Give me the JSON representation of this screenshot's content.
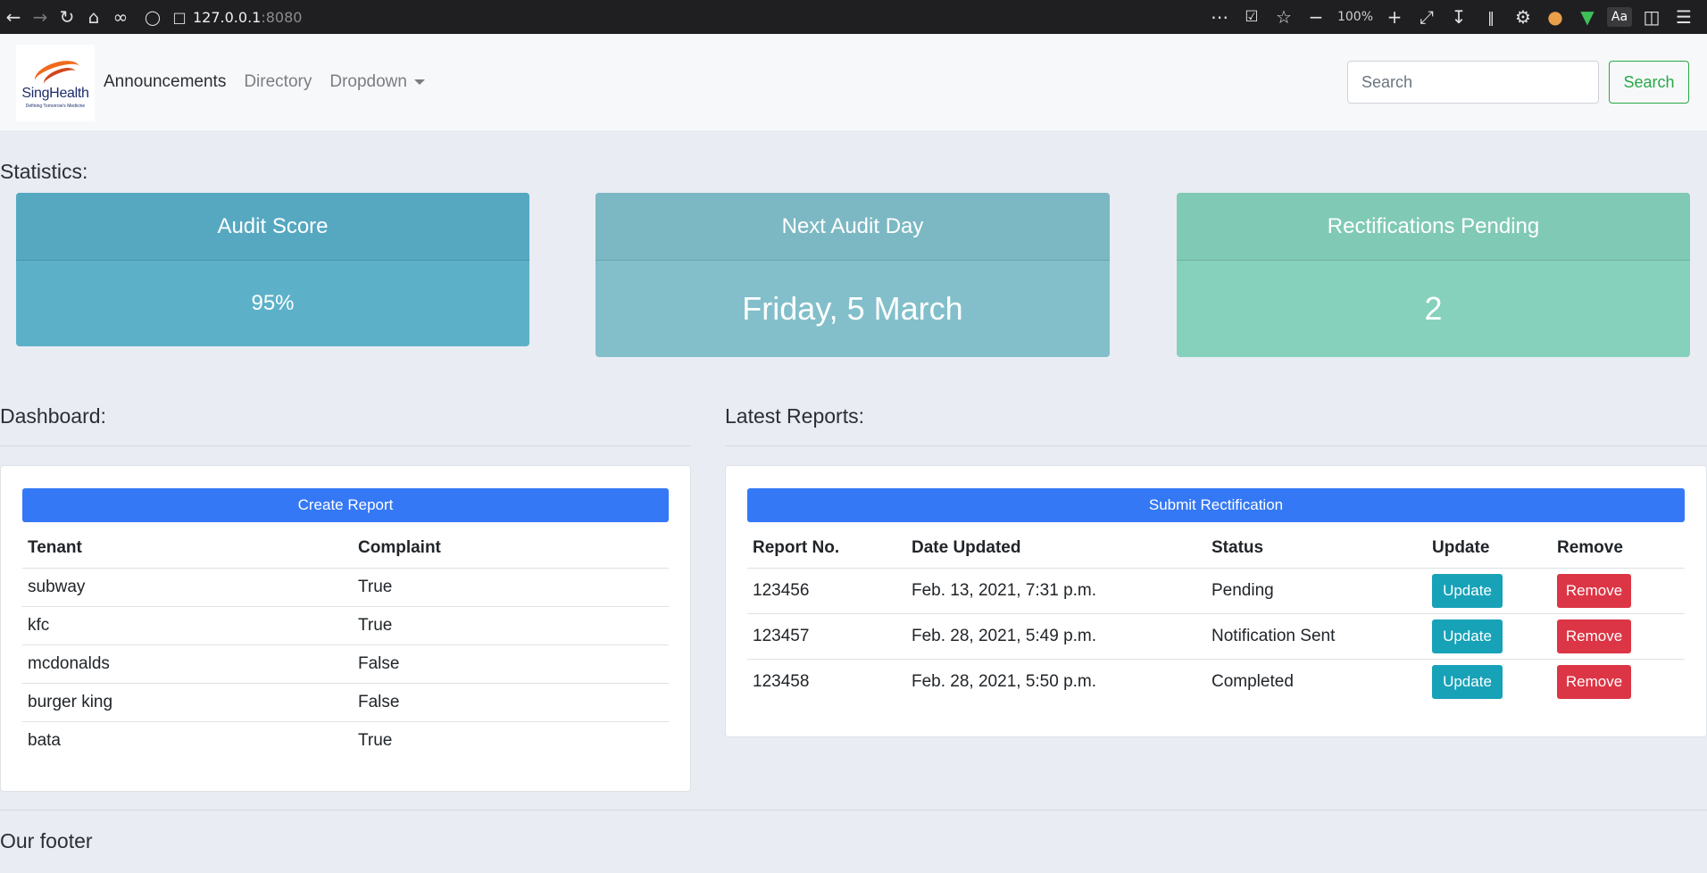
{
  "browser": {
    "url_host": "127.0.0.1",
    "url_port": ":8080",
    "zoom": "100%",
    "reader_label": "Aa"
  },
  "brand": {
    "logo_text": "SingHealth",
    "logo_tagline": "Defining Tomorrow's Medicine"
  },
  "nav": {
    "links": [
      "Announcements",
      "Directory",
      "Dropdown"
    ],
    "search_placeholder": "Search",
    "search_button": "Search"
  },
  "statistics": {
    "heading": "Statistics:",
    "cards": [
      {
        "title": "Audit Score",
        "value": "95%"
      },
      {
        "title": "Next Audit Day",
        "value": "Friday, 5 March"
      },
      {
        "title": "Rectifications Pending",
        "value": "2"
      }
    ]
  },
  "dashboard": {
    "heading": "Dashboard:",
    "button": "Create Report",
    "columns": [
      "Tenant",
      "Complaint"
    ],
    "rows": [
      [
        "subway",
        "True"
      ],
      [
        "kfc",
        "True"
      ],
      [
        "mcdonalds",
        "False"
      ],
      [
        "burger king",
        "False"
      ],
      [
        "bata",
        "True"
      ]
    ]
  },
  "reports": {
    "heading": "Latest Reports:",
    "button": "Submit Rectification",
    "columns": [
      "Report No.",
      "Date Updated",
      "Status",
      "Update",
      "Remove"
    ],
    "update_label": "Update",
    "remove_label": "Remove",
    "rows": [
      [
        "123456",
        "Feb. 13, 2021, 7:31 p.m.",
        "Pending"
      ],
      [
        "123457",
        "Feb. 28, 2021, 5:49 p.m.",
        "Notification Sent"
      ],
      [
        "123458",
        "Feb. 28, 2021, 5:50 p.m.",
        "Completed"
      ]
    ]
  },
  "footer": {
    "text": "Our footer"
  },
  "colors": {
    "primary": "#3478f6",
    "info": "#17a2b8",
    "danger": "#dc3545",
    "success": "#28a745",
    "card_audit": "#5cb1c8",
    "card_next": "#82bfca",
    "card_pending": "#86d1bc"
  }
}
